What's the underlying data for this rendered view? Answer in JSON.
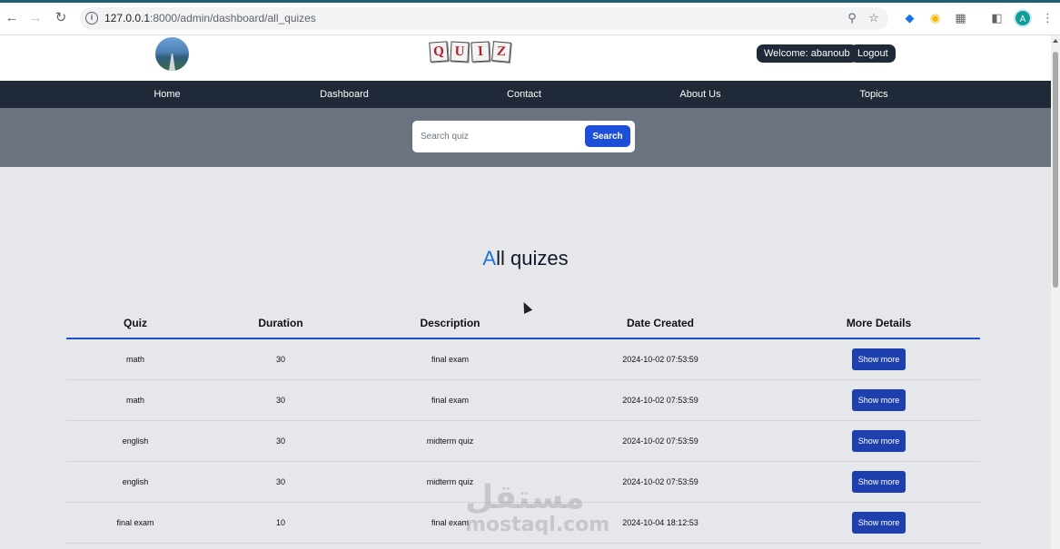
{
  "browser": {
    "url_host": "127.0.0.1",
    "url_rest": ":8000/admin/dashboard/all_quizes",
    "profile_initial": "A"
  },
  "header": {
    "logo_letters": [
      "Q",
      "U",
      "I",
      "Z"
    ],
    "welcome": "Welcome: abanoub",
    "logout": "Logout"
  },
  "nav": {
    "items": [
      "Home",
      "Dashboard",
      "Contact",
      "About Us",
      "Topics"
    ]
  },
  "search": {
    "placeholder": "Search quiz",
    "button": "Search"
  },
  "main": {
    "title_accent": "A",
    "title_rest": "ll quizes",
    "table": {
      "headers": [
        "Quiz",
        "Duration",
        "Description",
        "Date Created",
        "More Details"
      ],
      "rows": [
        {
          "quiz": "math",
          "duration": "30",
          "description": "final exam",
          "date": "2024-10-02 07:53:59",
          "action": "Show more"
        },
        {
          "quiz": "math",
          "duration": "30",
          "description": "final exam",
          "date": "2024-10-02 07:53:59",
          "action": "Show more"
        },
        {
          "quiz": "english",
          "duration": "30",
          "description": "midterm quiz",
          "date": "2024-10-02 07:53:59",
          "action": "Show more"
        },
        {
          "quiz": "english",
          "duration": "30",
          "description": "midterm quiz",
          "date": "2024-10-02 07:53:59",
          "action": "Show more"
        },
        {
          "quiz": "final exam",
          "duration": "10",
          "description": "final exam",
          "date": "2024-10-04 18:12:53",
          "action": "Show more"
        }
      ]
    }
  },
  "watermark": {
    "arabic": "مستقل",
    "latin": "mostaql.com"
  }
}
